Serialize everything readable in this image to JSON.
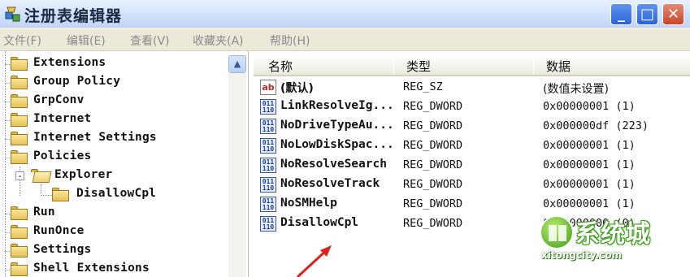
{
  "window": {
    "title": "注册表编辑器",
    "minimize_icon": "minimize-icon",
    "maximize_icon": "maximize-icon",
    "close_icon": "close-icon",
    "min_label": "_",
    "max_label": "□",
    "close_label": "✕"
  },
  "menu": {
    "items": [
      "文件(F)",
      "编辑(E)",
      "查看(V)",
      "收藏夹(A)",
      "帮助(H)"
    ]
  },
  "tree": {
    "items": [
      {
        "label": "Extensions",
        "expander": "+"
      },
      {
        "label": "Group Policy",
        "expander": "+"
      },
      {
        "label": "GrpConv",
        "expander": "+"
      },
      {
        "label": "Internet",
        "expander": "+"
      },
      {
        "label": "Internet Settings",
        "expander": "+"
      },
      {
        "label": "Policies",
        "expander": "-"
      },
      {
        "label": "Explorer",
        "expander": "-"
      },
      {
        "label": "DisallowCpl",
        "expander": ""
      },
      {
        "label": "Run",
        "expander": ""
      },
      {
        "label": "RunOnce",
        "expander": ""
      },
      {
        "label": "Settings",
        "expander": "+"
      },
      {
        "label": "Shell Extensions",
        "expander": "+"
      }
    ],
    "scroll_up_glyph": "▲"
  },
  "list": {
    "headers": {
      "name": "名称",
      "type": "类型",
      "data": "数据"
    },
    "rows": [
      {
        "icon": "string-value-icon",
        "name": "(默认)",
        "type": "REG_SZ",
        "data": "(数值未设置)"
      },
      {
        "icon": "dword-value-icon",
        "name": "LinkResolveIg...",
        "type": "REG_DWORD",
        "data": "0x00000001 (1)"
      },
      {
        "icon": "dword-value-icon",
        "name": "NoDriveTypeAu...",
        "type": "REG_DWORD",
        "data": "0x000000df (223)"
      },
      {
        "icon": "dword-value-icon",
        "name": "NoLowDiskSpac...",
        "type": "REG_DWORD",
        "data": "0x00000001 (1)"
      },
      {
        "icon": "dword-value-icon",
        "name": "NoResolveSearch",
        "type": "REG_DWORD",
        "data": "0x00000001 (1)"
      },
      {
        "icon": "dword-value-icon",
        "name": "NoResolveTrack",
        "type": "REG_DWORD",
        "data": "0x00000001 (1)"
      },
      {
        "icon": "dword-value-icon",
        "name": "NoSMHelp",
        "type": "REG_DWORD",
        "data": "0x00000001 (1)"
      },
      {
        "icon": "dword-value-icon",
        "name": "DisallowCpl",
        "type": "REG_DWORD",
        "data": "0x00000000 (0)"
      }
    ]
  },
  "watermark": {
    "brand": "系统城",
    "site": "xitongcity.com"
  },
  "colors": {
    "accent_blue": "#2b63d6",
    "close_red": "#c8462a",
    "arrow_red": "#e0201b",
    "watermark_green": "#3f9a1b"
  }
}
